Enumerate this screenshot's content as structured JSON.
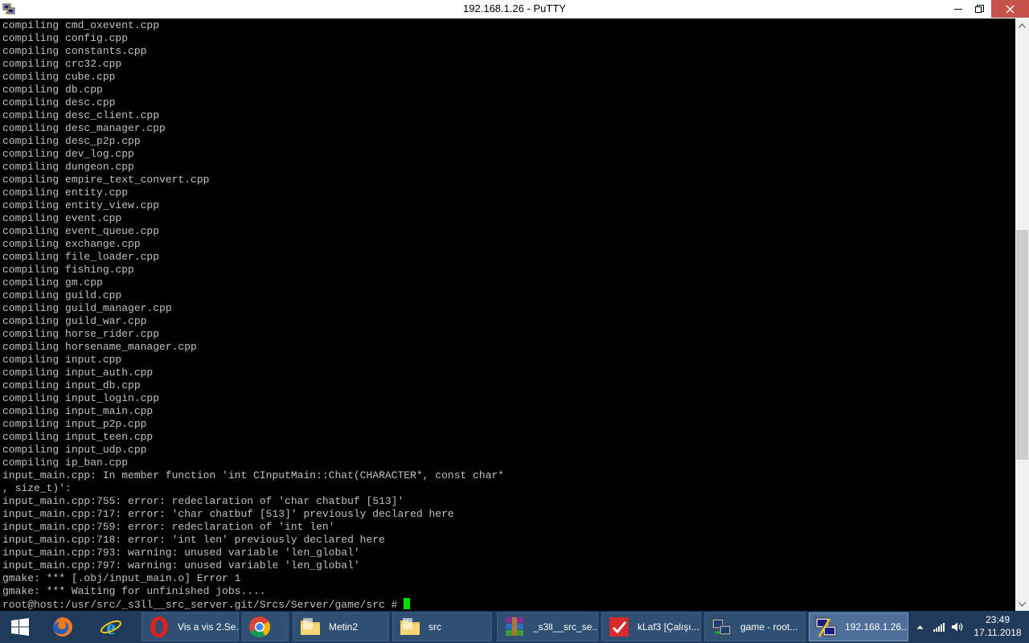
{
  "window": {
    "title": "192.168.1.26 - PuTTY",
    "icon": "putty-icon",
    "buttons": {
      "minimize": "minimize-icon",
      "maximize": "restore-icon",
      "close": "close-icon"
    }
  },
  "terminal": {
    "text_color": "#c0c0c0",
    "background": "#000000",
    "cursor_color": "#00e000",
    "lines": [
      "compiling cmd_oxevent.cpp",
      "compiling config.cpp",
      "compiling constants.cpp",
      "compiling crc32.cpp",
      "compiling cube.cpp",
      "compiling db.cpp",
      "compiling desc.cpp",
      "compiling desc_client.cpp",
      "compiling desc_manager.cpp",
      "compiling desc_p2p.cpp",
      "compiling dev_log.cpp",
      "compiling dungeon.cpp",
      "compiling empire_text_convert.cpp",
      "compiling entity.cpp",
      "compiling entity_view.cpp",
      "compiling event.cpp",
      "compiling event_queue.cpp",
      "compiling exchange.cpp",
      "compiling file_loader.cpp",
      "compiling fishing.cpp",
      "compiling gm.cpp",
      "compiling guild.cpp",
      "compiling guild_manager.cpp",
      "compiling guild_war.cpp",
      "compiling horse_rider.cpp",
      "compiling horsename_manager.cpp",
      "compiling input.cpp",
      "compiling input_auth.cpp",
      "compiling input_db.cpp",
      "compiling input_login.cpp",
      "compiling input_main.cpp",
      "compiling input_p2p.cpp",
      "compiling input_teen.cpp",
      "compiling input_udp.cpp",
      "compiling ip_ban.cpp",
      "input_main.cpp: In member function 'int CInputMain::Chat(CHARACTER*, const char*",
      ", size_t)':",
      "input_main.cpp:755: error: redeclaration of 'char chatbuf [513]'",
      "input_main.cpp:717: error: 'char chatbuf [513]' previously declared here",
      "input_main.cpp:759: error: redeclaration of 'int len'",
      "input_main.cpp:718: error: 'int len' previously declared here",
      "input_main.cpp:793: warning: unused variable 'len_global'",
      "input_main.cpp:797: warning: unused variable 'len_global'",
      "gmake: *** [.obj/input_main.o] Error 1",
      "gmake: *** Waiting for unfinished jobs...."
    ],
    "prompt": "root@host:/usr/src/_s3ll__src_server.git/Srcs/Server/game/src # "
  },
  "scrollbar": {
    "position": 0.59
  },
  "taskbar": {
    "background": "#1f3a5a",
    "start": "windows-start-icon",
    "pinned": [
      {
        "name": "firefox-icon"
      },
      {
        "name": "internet-explorer-icon"
      }
    ],
    "tasks": [
      {
        "icon": "opera-icon",
        "label": "Vis a vis 2.Se..."
      },
      {
        "icon": "chrome-icon",
        "label": ""
      },
      {
        "icon": "folder-icon",
        "label": "Metin2"
      },
      {
        "icon": "folder-icon",
        "label": "src"
      },
      {
        "icon": "winrar-icon",
        "label": "_s3ll__src_se..."
      },
      {
        "icon": "klaf-icon",
        "label": "kLaf3 [Çalışı..."
      },
      {
        "icon": "winscp-icon",
        "label": "game - root..."
      },
      {
        "icon": "putty-icon",
        "label": "192.168.1.26..."
      }
    ],
    "tray": {
      "icons": [
        "show-hidden-icon",
        "network-signal-icon",
        "volume-icon"
      ],
      "time": "23:49",
      "date": "17.11.2018"
    }
  }
}
